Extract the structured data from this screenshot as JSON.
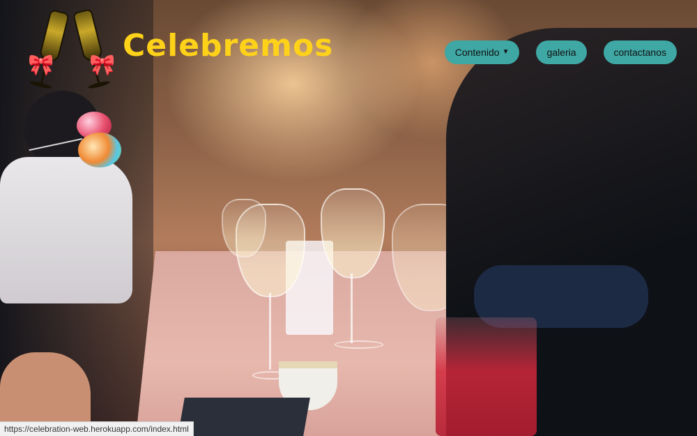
{
  "site": {
    "brand": "Celebremos",
    "logo_icon": "champagne-glasses-icon",
    "decoration_icon": "balloons-icon"
  },
  "nav": {
    "items": [
      {
        "label": "Contenido",
        "has_dropdown": true
      },
      {
        "label": "galeria",
        "has_dropdown": false
      },
      {
        "label": "contactanos",
        "has_dropdown": false
      }
    ]
  },
  "status_bar": {
    "url": "https://celebration-web.herokuapp.com/index.html"
  },
  "colors": {
    "brand_text": "#ffd21a",
    "nav_button_bg": "#3fa7a4",
    "nav_button_text": "#111111"
  }
}
